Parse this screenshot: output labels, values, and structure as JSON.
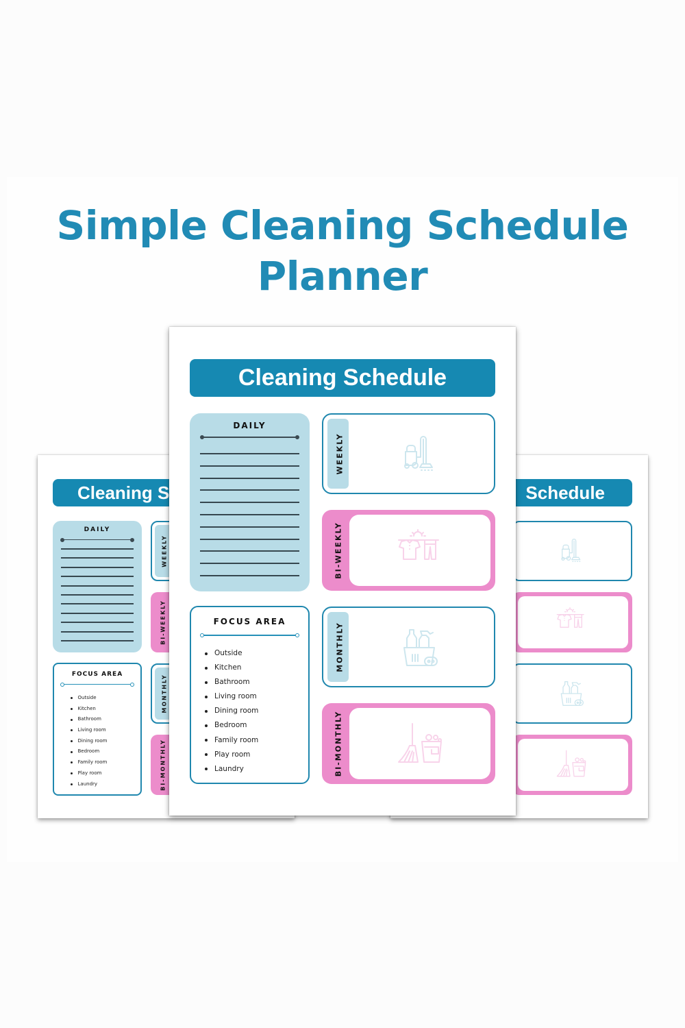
{
  "headline": {
    "line1": "Simple Cleaning Schedule",
    "line2": "Planner"
  },
  "planner": {
    "title": "Cleaning Schedule",
    "title_left_visible": "Cleaning S",
    "title_right_visible": "Schedule",
    "daily": {
      "heading": "DAILY",
      "blank_lines": 11
    },
    "focus_area": {
      "heading": "FOCUS AREA",
      "items": [
        "Outside",
        "Kitchen",
        "Bathroom",
        "Living room",
        "Dining room",
        "Bedroom",
        "Family room",
        "Play room",
        "Laundry"
      ]
    },
    "frequencies": [
      {
        "label": "WEEKLY",
        "style": "blue",
        "icon": "vacuum-cleaner-icon"
      },
      {
        "label": "BI-WEEKLY",
        "style": "pink",
        "icon": "laundry-line-icon"
      },
      {
        "label": "MONTHLY",
        "style": "blue",
        "icon": "cleaning-supplies-icon"
      },
      {
        "label": "BI-MONTHLY",
        "style": "pink",
        "icon": "broom-bucket-icon"
      }
    ]
  },
  "colors": {
    "headline": "#218bb5",
    "title_bar": "#1689b2",
    "light_blue": "#b8dce7",
    "pink": "#ec8ccb",
    "border_blue": "#1f87ae"
  }
}
